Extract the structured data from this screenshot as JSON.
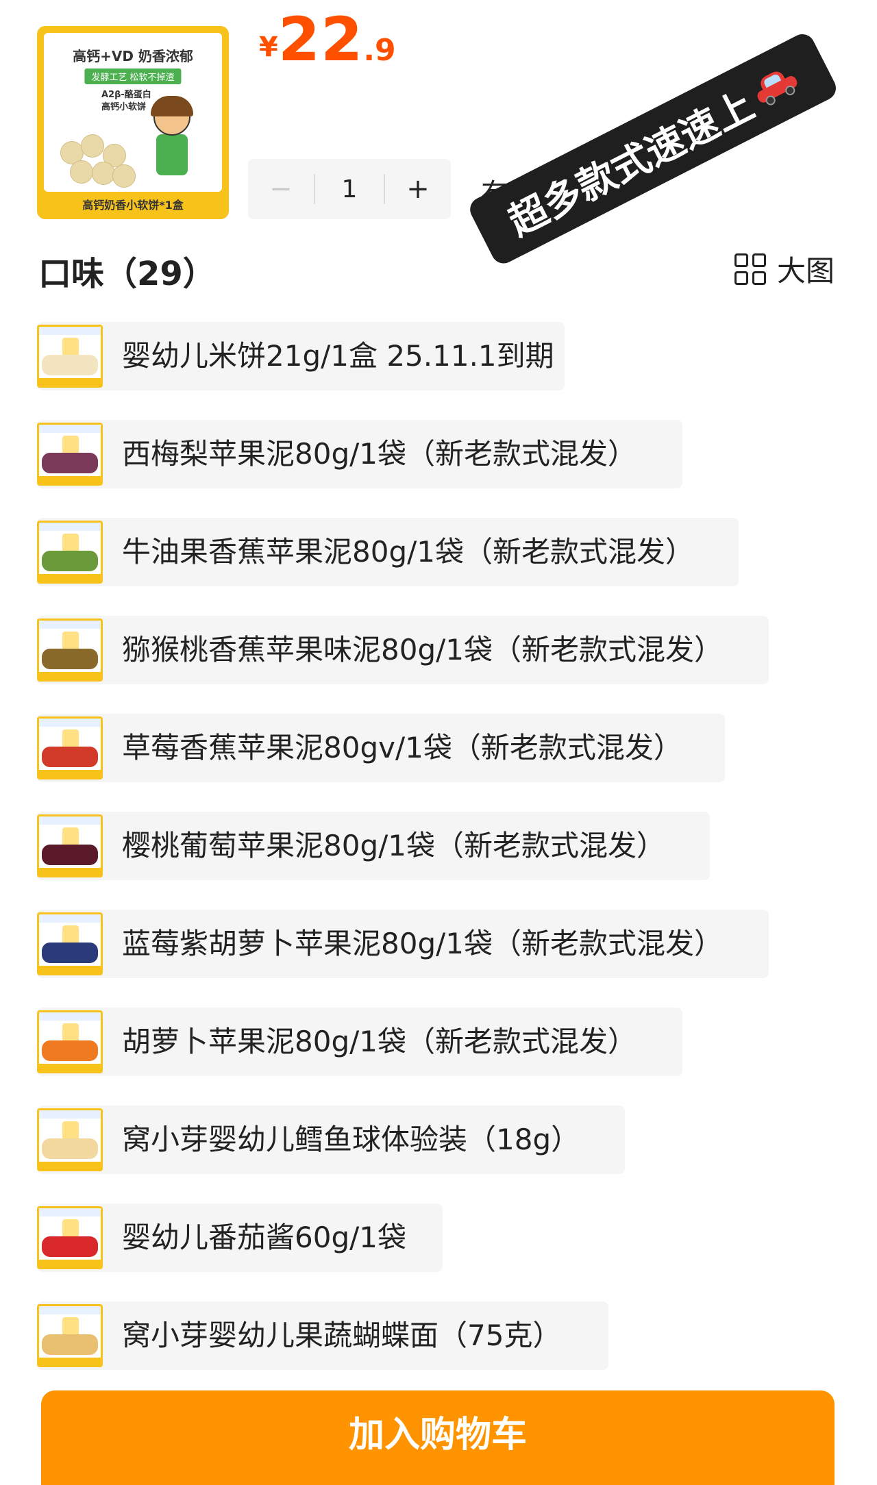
{
  "product": {
    "thumb_title": "高钙+VD 奶香浓郁",
    "thumb_tag": "发酵工艺 松软不掉渣",
    "thumb_text": "A2β-酪蛋白 高钙小软饼",
    "thumb_caption": "高钙奶香小软饼*1盒"
  },
  "price": {
    "currency": "¥",
    "integer": "22",
    "decimal": ".9",
    "color": "#ff5000"
  },
  "quantity": {
    "value": "1",
    "minus_label": "−",
    "plus_label": "+"
  },
  "stock_label": "有货",
  "promo": {
    "text": "超多款式速速上",
    "icon": "car-icon"
  },
  "flavor": {
    "title": "口味（29）",
    "view_label": "大图",
    "view_icon": "grid-icon"
  },
  "variants": [
    {
      "label": "婴幼儿米饼21g/1盒 25.11.1到期",
      "fruit_color": "#f3e5c0"
    },
    {
      "label": "西梅梨苹果泥80g/1袋（新老款式混发）",
      "fruit_color": "#7b3a5a"
    },
    {
      "label": "牛油果香蕉苹果泥80g/1袋（新老款式混发）",
      "fruit_color": "#6a9a3a"
    },
    {
      "label": "猕猴桃香蕉苹果味泥80g/1袋（新老款式混发）",
      "fruit_color": "#8a6a2a"
    },
    {
      "label": "草莓香蕉苹果泥80gv/1袋（新老款式混发）",
      "fruit_color": "#d23a2a"
    },
    {
      "label": "樱桃葡萄苹果泥80g/1袋（新老款式混发）",
      "fruit_color": "#5a1a2a"
    },
    {
      "label": "蓝莓紫胡萝卜苹果泥80g/1袋（新老款式混发）",
      "fruit_color": "#2a3a7a"
    },
    {
      "label": "胡萝卜苹果泥80g/1袋（新老款式混发）",
      "fruit_color": "#f07a20"
    },
    {
      "label": "窝小芽婴幼儿鳕鱼球体验装（18g）",
      "fruit_color": "#f3d9a0"
    },
    {
      "label": "婴幼儿番茄酱60g/1袋",
      "fruit_color": "#d8282a"
    },
    {
      "label": "窝小芽婴幼儿果蔬蝴蝶面（75克）",
      "fruit_color": "#e8c070"
    }
  ],
  "cart_button": {
    "label": "加入购物车",
    "color": "#ff9400"
  }
}
